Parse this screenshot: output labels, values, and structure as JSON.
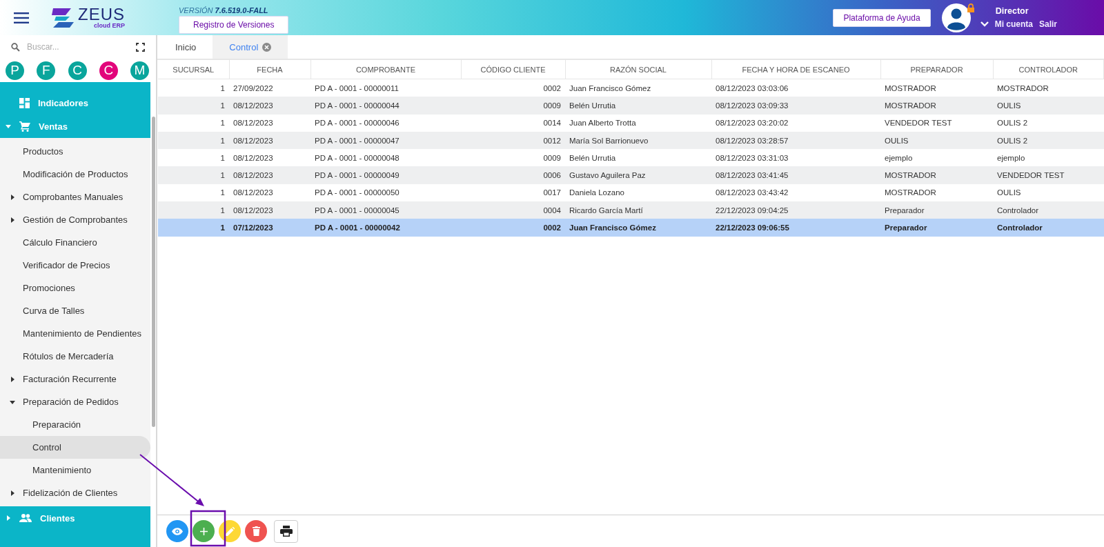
{
  "header": {
    "logo": {
      "name": "ZEUS",
      "tagline": "cloud ERP"
    },
    "version_label": "VERSIÓN",
    "version": "7.6.519.0-FALL",
    "versions_button": "Registro de Versiones",
    "help_button": "Plataforma de Ayuda",
    "user": {
      "role": "Director",
      "account_link": "Mi cuenta",
      "logout_link": "Salir",
      "locked": true
    }
  },
  "sidebar": {
    "search": {
      "placeholder": "Buscar..."
    },
    "shortcuts": [
      {
        "letter": "P",
        "color": "#0aa59c"
      },
      {
        "letter": "F",
        "color": "#0aa59c"
      },
      {
        "letter": "C",
        "color": "#0aa59c"
      },
      {
        "letter": "C",
        "color": "#e2057b"
      },
      {
        "letter": "M",
        "color": "#0aa59c"
      }
    ],
    "sections": [
      {
        "label": "Indicadores",
        "selected": false
      },
      {
        "label": "Ventas",
        "selected": false,
        "expanded": true,
        "children": [
          {
            "label": "Productos",
            "selected": false
          },
          {
            "label": "Modificación de Productos",
            "selected": false
          },
          {
            "label": "Comprobantes Manuales",
            "selected": false,
            "expanded": false
          },
          {
            "label": "Gestión de Comprobantes",
            "selected": false,
            "expanded": false
          },
          {
            "label": "Cálculo Financiero",
            "selected": false
          },
          {
            "label": "Verificador de Precios",
            "selected": false
          },
          {
            "label": "Promociones",
            "selected": false
          },
          {
            "label": "Curva de Talles",
            "selected": false
          },
          {
            "label": "Mantenimiento de Pendientes",
            "selected": false
          },
          {
            "label": "Rótulos de Mercadería",
            "selected": false
          },
          {
            "label": "Facturación Recurrente",
            "selected": false,
            "expanded": false
          },
          {
            "label": "Preparación de Pedidos",
            "selected": false,
            "expanded": true,
            "children": [
              {
                "label": "Preparación",
                "selected": false
              },
              {
                "label": "Control",
                "selected": true
              },
              {
                "label": "Mantenimiento",
                "selected": false
              }
            ]
          },
          {
            "label": "Fidelización de Clientes",
            "selected": false,
            "expanded": false
          }
        ]
      },
      {
        "label": "Clientes",
        "selected": false,
        "expanded": false
      }
    ]
  },
  "tabs": [
    {
      "label": "Inicio",
      "selected": false,
      "closable": false
    },
    {
      "label": "Control",
      "selected": true,
      "closable": true
    }
  ],
  "table": {
    "columns": [
      {
        "label": "SUCURSAL"
      },
      {
        "label": "FECHA"
      },
      {
        "label": "COMPROBANTE"
      },
      {
        "label": "CÓDIGO CLIENTE"
      },
      {
        "label": "RAZÓN SOCIAL"
      },
      {
        "label": "FECHA Y HORA DE ESCANEO"
      },
      {
        "label": "PREPARADOR"
      },
      {
        "label": "CONTROLADOR"
      }
    ],
    "rows": [
      {
        "selected": false,
        "cells": [
          "1",
          "27/09/2022",
          "PD A - 0001 - 00000011",
          "0002",
          "Juan Francisco Gómez",
          "08/12/2023 03:03:06",
          "MOSTRADOR",
          "MOSTRADOR"
        ]
      },
      {
        "selected": false,
        "cells": [
          "1",
          "08/12/2023",
          "PD A - 0001 - 00000044",
          "0009",
          "Belén Urrutia",
          "08/12/2023 03:09:33",
          "MOSTRADOR",
          "OULIS"
        ]
      },
      {
        "selected": false,
        "cells": [
          "1",
          "08/12/2023",
          "PD A - 0001 - 00000046",
          "0014",
          "Juan Alberto Trotta",
          "08/12/2023 03:20:02",
          "VENDEDOR TEST",
          "OULIS 2"
        ]
      },
      {
        "selected": false,
        "cells": [
          "1",
          "08/12/2023",
          "PD A - 0001 - 00000047",
          "0012",
          "María Sol Barrionuevo",
          "08/12/2023 03:28:57",
          "OULIS",
          "OULIS 2"
        ]
      },
      {
        "selected": false,
        "cells": [
          "1",
          "08/12/2023",
          "PD A - 0001 - 00000048",
          "0009",
          "Belén Urrutia",
          "08/12/2023 03:31:03",
          "ejemplo",
          "ejemplo"
        ]
      },
      {
        "selected": false,
        "cells": [
          "1",
          "08/12/2023",
          "PD A - 0001 - 00000049",
          "0006",
          "Gustavo Aguilera Paz",
          "08/12/2023 03:41:45",
          "MOSTRADOR",
          "VENDEDOR TEST"
        ]
      },
      {
        "selected": false,
        "cells": [
          "1",
          "08/12/2023",
          "PD A - 0001 - 00000050",
          "0017",
          "Daniela Lozano",
          "08/12/2023 03:43:42",
          "MOSTRADOR",
          "OULIS"
        ]
      },
      {
        "selected": false,
        "cells": [
          "1",
          "08/12/2023",
          "PD A - 0001 - 00000045",
          "0004",
          "Ricardo García Martí",
          "22/12/2023 09:04:25",
          "Preparador",
          "Controlador"
        ]
      },
      {
        "selected": true,
        "cells": [
          "1",
          "07/12/2023",
          "PD A - 0001 - 00000042",
          "0002",
          "Juan Francisco Gómez",
          "22/12/2023 09:06:55",
          "Preparador",
          "Controlador"
        ]
      }
    ]
  },
  "toolbar": [
    {
      "kind": "view",
      "color": "#2196f3"
    },
    {
      "kind": "add",
      "color": "#4caf50"
    },
    {
      "kind": "edit",
      "color": "#fdd835"
    },
    {
      "kind": "delete",
      "color": "#ef5350"
    },
    {
      "kind": "print",
      "color": "#ffffff"
    }
  ],
  "annotation": {
    "highlight": true
  }
}
